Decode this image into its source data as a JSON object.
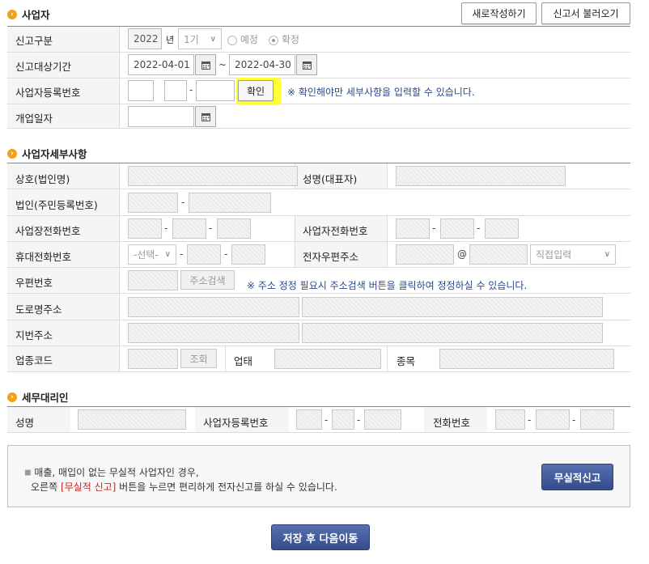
{
  "sections": {
    "business": "사업자",
    "detail": "사업자세부사항",
    "agent": "세무대리인"
  },
  "buttons": {
    "new_write": "새로작성하기",
    "load": "신고서 불러오기",
    "confirm": "확인",
    "addr_search": "주소검색",
    "lookup": "조회",
    "nil_report": "무실적신고",
    "save_next": "저장 후 다음이동"
  },
  "business": {
    "labels": {
      "report_type": "신고구분",
      "period": "신고대상기간",
      "reg_no": "사업자등록번호",
      "open_date": "개업일자"
    },
    "year": "2022",
    "year_unit": "년",
    "term": "1기",
    "radio_planned": "예정",
    "radio_final": "확정",
    "period_from": "2022-04-01",
    "period_sep": "~",
    "period_to": "2022-04-30",
    "confirm_note": "※ 확인해야만 세부사항을 입력할 수 있습니다."
  },
  "detail": {
    "labels": {
      "company": "상호(법인명)",
      "rep_name": "성명(대표자)",
      "corp_no": "법인(주민등록번호)",
      "biz_phone": "사업장전화번호",
      "biz_phone2": "사업자전화번호",
      "mobile": "휴대전화번호",
      "email": "전자우편주소",
      "zipcode": "우편번호",
      "road_addr": "도로명주소",
      "lot_addr": "지번주소",
      "industry_code": "업종코드",
      "biz_type": "업태",
      "biz_item": "종목"
    },
    "mobile_select": "-선택-",
    "email_at": "@",
    "email_domain": "직접입력",
    "zip_note": "※ 주소 정정 필요시 주소검색 버튼을 클릭하여 정정하실 수 있습니다."
  },
  "agent": {
    "labels": {
      "name": "성명",
      "reg_no": "사업자등록번호",
      "phone": "전화번호"
    }
  },
  "notice": {
    "line1": "매출, 매입이 없는 무실적 사업자인 경우,",
    "line2_pre": "오른쪽",
    "line2_highlight": "[무실적 신고]",
    "line2_post": "버튼을 누르면 편리하게 전자신고를 하실 수 있습니다."
  },
  "colors": {
    "highlight": "#ffff33",
    "accent_red": "#cc2222",
    "note_blue": "#2a4a88",
    "button_blue": "#3d5596"
  }
}
